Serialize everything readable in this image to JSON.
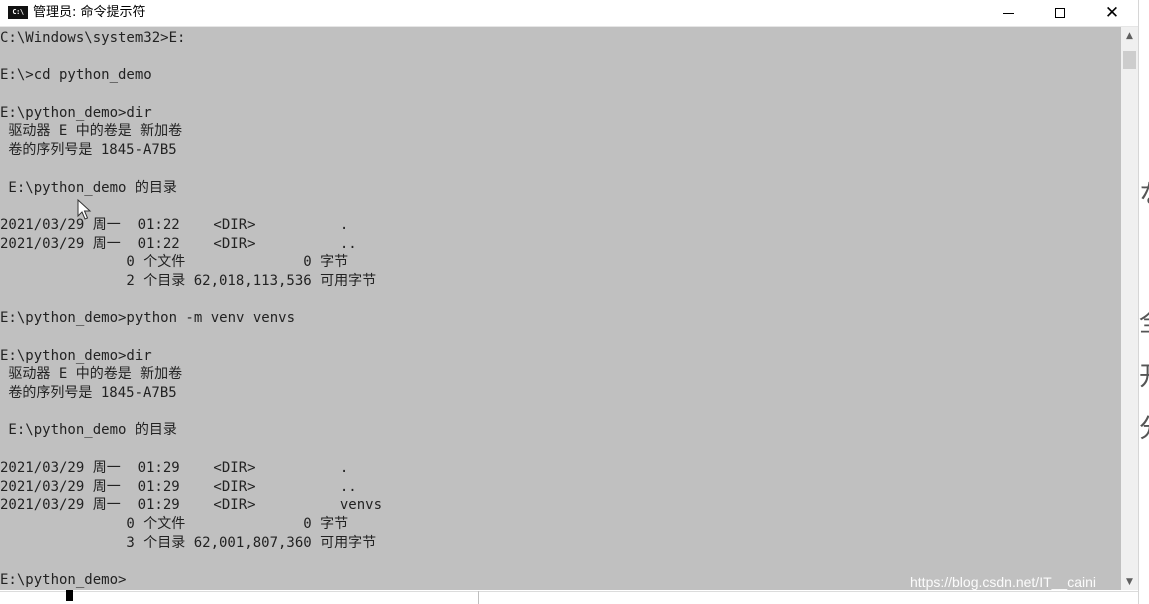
{
  "window": {
    "title": "管理员: 命令提示符",
    "icon_label": "C:\\",
    "buttons": {
      "minimize": "minimize",
      "maximize": "maximize",
      "close": "✕"
    }
  },
  "console": {
    "lines": [
      "C:\\Windows\\system32>E:",
      "",
      "E:\\>cd python_demo",
      "",
      "E:\\python_demo>dir",
      " 驱动器 E 中的卷是 新加卷",
      " 卷的序列号是 1845-A7B5",
      "",
      " E:\\python_demo 的目录",
      "",
      "2021/03/29 周一  01:22    <DIR>          .",
      "2021/03/29 周一  01:22    <DIR>          ..",
      "               0 个文件              0 字节",
      "               2 个目录 62,018,113,536 可用字节",
      "",
      "E:\\python_demo>python -m venv venvs",
      "",
      "E:\\python_demo>dir",
      " 驱动器 E 中的卷是 新加卷",
      " 卷的序列号是 1845-A7B5",
      "",
      " E:\\python_demo 的目录",
      "",
      "2021/03/29 周一  01:29    <DIR>          .",
      "2021/03/29 周一  01:29    <DIR>          ..",
      "2021/03/29 周一  01:29    <DIR>          venvs",
      "               0 个文件              0 字节",
      "               3 个目录 62,001,807,360 可用字节",
      "",
      "E:\\python_demo>"
    ],
    "colors": {
      "background": "#c0c0c0",
      "text": "#222222"
    }
  },
  "scrollbar": {
    "up_arrow": "▲",
    "down_arrow": "▼"
  },
  "background_page": {
    "glyphs": [
      "な",
      "全",
      "开",
      "分"
    ]
  },
  "watermark": "https://blog.csdn.net/IT__caini"
}
